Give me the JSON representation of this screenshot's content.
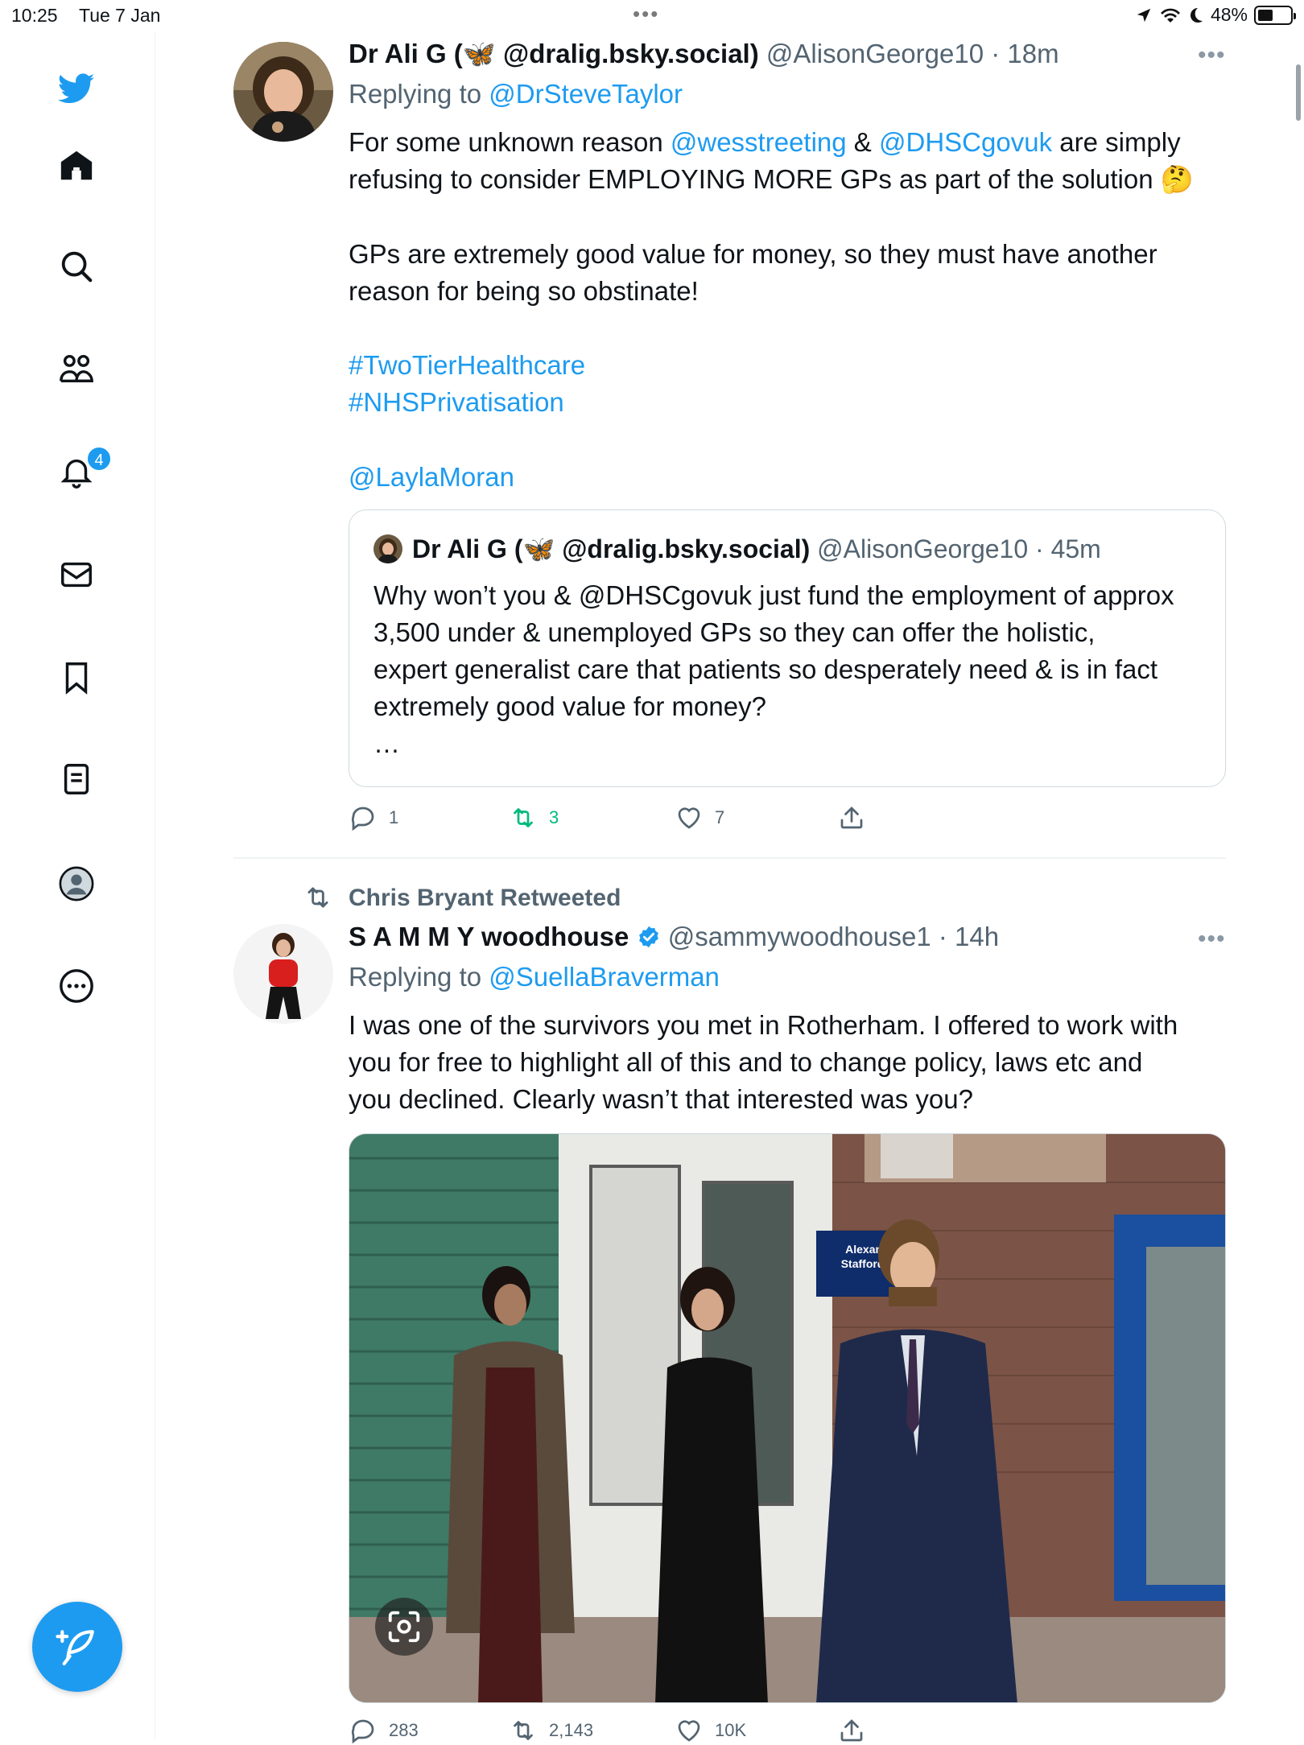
{
  "status_bar": {
    "time": "10:25",
    "date": "Tue 7 Jan",
    "dots": "•••",
    "battery": "48%",
    "battery_level": 0.48
  },
  "sidebar": {
    "items": [
      {
        "icon": "twitter-logo-icon"
      },
      {
        "icon": "home-icon"
      },
      {
        "icon": "search-icon"
      },
      {
        "icon": "communities-icon"
      },
      {
        "icon": "notifications-icon",
        "badge": "4"
      },
      {
        "icon": "messages-icon"
      },
      {
        "icon": "bookmarks-icon"
      },
      {
        "icon": "lists-icon"
      },
      {
        "icon": "profile-icon"
      },
      {
        "icon": "more-icon"
      }
    ],
    "compose_icon": "compose-feather-icon"
  },
  "tweet1": {
    "name": "Dr Ali G (🦋 @dralig.bsky.social)",
    "handle": "@AlisonGeorge10",
    "time": "· 18m",
    "replying_prefix": "Replying to",
    "replying_to": "@DrSteveTaylor",
    "body": {
      "l1_a": "For some unknown reason ",
      "l1_m1": "@wesstreeting",
      "l1_b": " & ",
      "l1_m2": "@DHSCgovuk",
      "l1_c": " are simply",
      "l2": "refusing to consider EMPLOYING MORE GPs as part of the solution 🤔",
      "l3": "GPs are extremely good value for money, so they must have another",
      "l4": "reason for being so obstinate!",
      "h1": "#TwoTierHealthcare",
      "h2": "#NHSPrivatisation",
      "m3": "@LaylaMoran"
    },
    "quote": {
      "name": "Dr Ali G (🦋 @dralig.bsky.social)",
      "handle_time": "@AlisonGeorge10 · 45m",
      "l1": "Why won’t you & @DHSCgovuk just fund the employment of approx",
      "l2": "3,500 under & unemployed GPs so they can offer the holistic,",
      "l3": "expert generalist care that patients so desperately need & is in fact",
      "l4": "extremely good value for money?",
      "l5": "…"
    },
    "actions": {
      "replies": "1",
      "retweets": "3",
      "likes": "7"
    }
  },
  "tweet2": {
    "retweeted_by": "Chris Bryant Retweeted",
    "name": "S A M M Y woodhouse",
    "handle": "@sammywoodhouse1",
    "time": "· 14h",
    "replying_prefix": "Replying to",
    "replying_to": "@SuellaBraverman",
    "body": {
      "l1": "I was one of the survivors you met in Rotherham. I offered to work with",
      "l2": "you for free to highlight all of this and to change policy, laws etc and",
      "l3": "you declined. Clearly wasn’t that interested was you?"
    },
    "photo": {
      "sign_line1": "Alexander",
      "sign_line2": "Stafford MP",
      "lens_icon": "visual-search-icon"
    },
    "actions": {
      "replies": "283",
      "retweets": "2,143",
      "likes": "10K"
    }
  },
  "colors": {
    "accent": "#1d9bf0",
    "retweet_green": "#00ba7c",
    "muted": "#536471"
  }
}
